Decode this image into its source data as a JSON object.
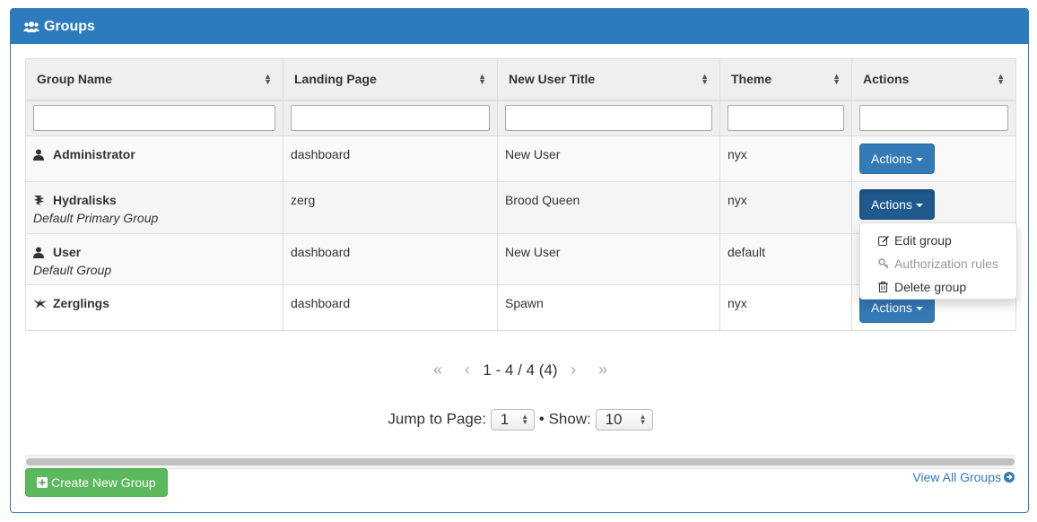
{
  "panel": {
    "title": "Groups",
    "icon": "users-icon"
  },
  "table": {
    "columns": [
      {
        "label": "Group Name"
      },
      {
        "label": "Landing Page"
      },
      {
        "label": "New User Title"
      },
      {
        "label": "Theme"
      },
      {
        "label": "Actions"
      }
    ],
    "filters": [
      "",
      "",
      "",
      "",
      ""
    ],
    "rows": [
      {
        "icon": "user-icon",
        "name": "Administrator",
        "subtitle": "",
        "landing_page": "dashboard",
        "new_user_title": "New User",
        "theme": "nyx",
        "action_label": "Actions"
      },
      {
        "icon": "hydralisk-icon",
        "name": "Hydralisks",
        "subtitle": "Default Primary Group",
        "landing_page": "zerg",
        "new_user_title": "Brood Queen",
        "theme": "nyx",
        "action_label": "Actions"
      },
      {
        "icon": "user-icon",
        "name": "User",
        "subtitle": "Default Group",
        "landing_page": "dashboard",
        "new_user_title": "New User",
        "theme": "default",
        "action_label": "Actions"
      },
      {
        "icon": "zergling-icon",
        "name": "Zerglings",
        "subtitle": "",
        "landing_page": "dashboard",
        "new_user_title": "Spawn",
        "theme": "nyx",
        "action_label": "Actions"
      }
    ]
  },
  "dropdown": {
    "items": [
      {
        "label": "Edit group",
        "icon": "edit-icon",
        "disabled": false
      },
      {
        "label": "Authorization rules",
        "icon": "key-icon",
        "disabled": true
      },
      {
        "label": "Delete group",
        "icon": "trash-icon",
        "disabled": false
      }
    ]
  },
  "pagination": {
    "first": "«",
    "prev": "‹",
    "summary": "1 - 4 / 4 (4)",
    "next": "›",
    "last": "»",
    "jump_label": "Jump to Page:",
    "page_value": "1",
    "separator": "•",
    "show_label": "Show:",
    "show_value": "10"
  },
  "footer": {
    "create_label": "Create New Group",
    "view_all_label": "View All Groups"
  }
}
